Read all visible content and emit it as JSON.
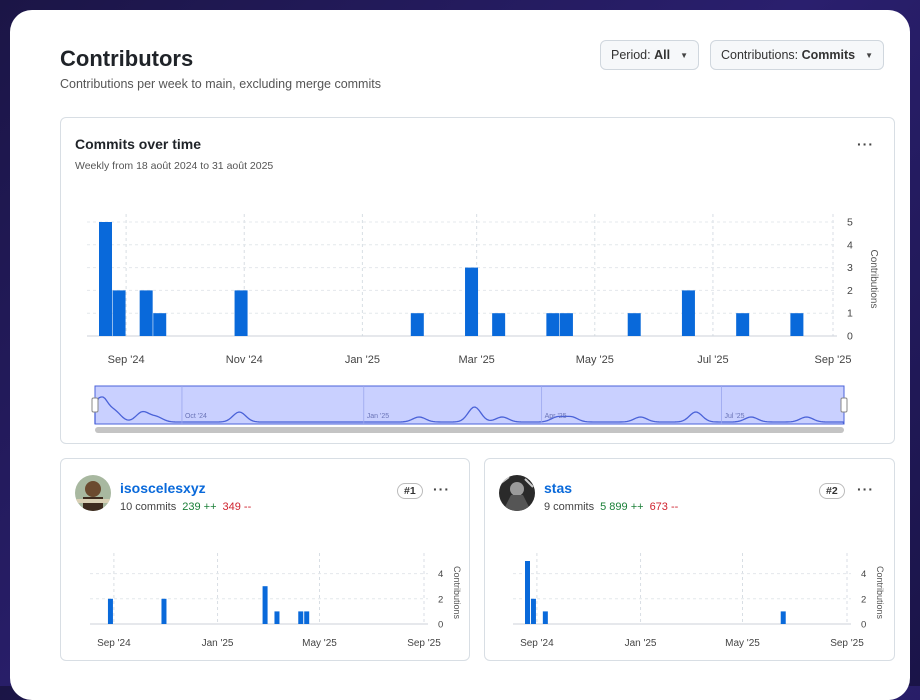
{
  "header": {
    "title": "Contributors",
    "subtitle": "Contributions per week to main, excluding merge commits",
    "period_label": "Period: ",
    "period_value": "All",
    "contrib_label": "Contributions: ",
    "contrib_value": "Commits"
  },
  "main_card": {
    "title": "Commits over time",
    "subtitle": "Weekly from 18 août 2024 to 31 août 2025",
    "menu_icon": "kebab-horizontal-icon"
  },
  "colors": {
    "bar": "#0969da",
    "brush_fill": "#c9d0ff",
    "brush_stroke": "#4a62d8",
    "additions": "#1a7f37",
    "deletions": "#cf222e"
  },
  "chart_data": [
    {
      "type": "bar",
      "title": "Commits over time",
      "subtitle": "Weekly from 18 août 2024 to 31 août 2025",
      "ylabel": "Contributions",
      "ylim": [
        0,
        5
      ],
      "y_ticks": [
        0,
        1,
        2,
        3,
        4,
        5
      ],
      "x_tick_labels": [
        "Sep '24",
        "Nov '24",
        "Jan '25",
        "Mar '25",
        "May '25",
        "Jul '25",
        "Sep '25"
      ],
      "x_range": [
        "2024-08-18",
        "2025-09-01"
      ],
      "points": [
        {
          "x": "2024-08-18",
          "y": 5
        },
        {
          "x": "2024-08-25",
          "y": 2
        },
        {
          "x": "2024-09-08",
          "y": 2
        },
        {
          "x": "2024-09-15",
          "y": 1
        },
        {
          "x": "2024-10-27",
          "y": 2
        },
        {
          "x": "2025-01-26",
          "y": 1
        },
        {
          "x": "2025-02-23",
          "y": 3
        },
        {
          "x": "2025-03-09",
          "y": 1
        },
        {
          "x": "2025-04-06",
          "y": 1
        },
        {
          "x": "2025-04-13",
          "y": 1
        },
        {
          "x": "2025-05-18",
          "y": 1
        },
        {
          "x": "2025-06-15",
          "y": 2
        },
        {
          "x": "2025-07-13",
          "y": 1
        },
        {
          "x": "2025-08-10",
          "y": 1
        }
      ],
      "brush_labels": [
        "Oct '24",
        "Jan '25",
        "Apr '25",
        "Jul '25"
      ]
    },
    {
      "type": "bar",
      "title": "isoscelesxyz",
      "ylabel": "Contributions",
      "ylim": [
        0,
        5
      ],
      "y_ticks": [
        0,
        2,
        4
      ],
      "x_tick_labels": [
        "Sep '24",
        "Jan '25",
        "May '25",
        "Sep '25"
      ],
      "x_range": [
        "2024-08-18",
        "2025-09-01"
      ],
      "points": [
        {
          "x": "2024-08-25",
          "y": 2
        },
        {
          "x": "2024-10-27",
          "y": 2
        },
        {
          "x": "2025-02-23",
          "y": 3
        },
        {
          "x": "2025-03-09",
          "y": 1
        },
        {
          "x": "2025-04-06",
          "y": 1
        },
        {
          "x": "2025-04-13",
          "y": 1
        }
      ]
    },
    {
      "type": "bar",
      "title": "stas",
      "ylabel": "Contributions",
      "ylim": [
        0,
        5
      ],
      "y_ticks": [
        0,
        2,
        4
      ],
      "x_tick_labels": [
        "Sep '24",
        "Jan '25",
        "May '25",
        "Sep '25"
      ],
      "x_range": [
        "2024-08-18",
        "2025-09-01"
      ],
      "points": [
        {
          "x": "2024-08-18",
          "y": 5
        },
        {
          "x": "2024-08-25",
          "y": 2
        },
        {
          "x": "2024-09-08",
          "y": 1
        },
        {
          "x": "2025-06-15",
          "y": 1
        }
      ]
    }
  ],
  "contributors": [
    {
      "username": "isoscelesxyz",
      "commits": "10 commits",
      "additions": "239 ++",
      "deletions": "349 --",
      "rank": "#1",
      "avatar_icon": "user-avatar-icon"
    },
    {
      "username": "stas",
      "commits": "9 commits",
      "additions": "5 899 ++",
      "deletions": "673 --",
      "rank": "#2",
      "avatar_icon": "user-avatar-icon"
    }
  ]
}
